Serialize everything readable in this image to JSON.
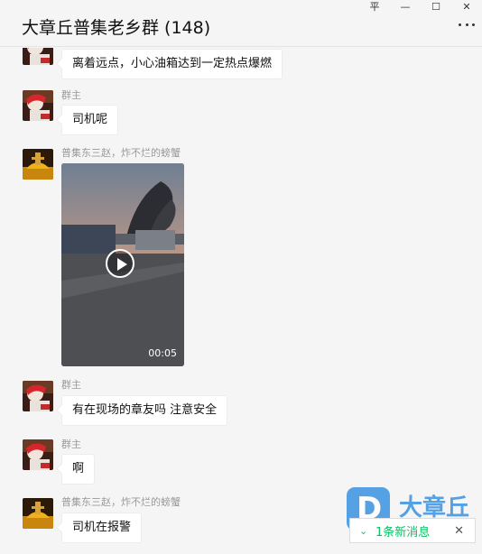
{
  "window": {
    "title": "大章丘普集老乡群 (148)",
    "controls": {
      "pin": "平",
      "minimize": "—",
      "maximize": "☐",
      "close": "✕"
    }
  },
  "messages": [
    {
      "type": "text",
      "sender": "",
      "text": "离着远点，小心油箱达到一定热点爆燃"
    },
    {
      "type": "text",
      "sender": "群主",
      "text": "司机呢"
    },
    {
      "type": "video",
      "sender": "普集东三赵，炸不烂的螃蟹",
      "duration": "00:05"
    },
    {
      "type": "text",
      "sender": "群主",
      "text": "有在现场的章友吗  注意安全"
    },
    {
      "type": "text",
      "sender": "群主",
      "text": "啊"
    },
    {
      "type": "text",
      "sender": "普集东三赵，炸不烂的螃蟹",
      "text": "司机在报警"
    }
  ],
  "new_message_bar": {
    "text": "1条新消息",
    "chevron": "⌄",
    "close": "✕"
  },
  "watermark": {
    "logo_letter": "D",
    "text": "大章丘"
  },
  "colors": {
    "accent": "#07c160",
    "watermark": "#2f8be0",
    "background": "#f5f5f5"
  }
}
